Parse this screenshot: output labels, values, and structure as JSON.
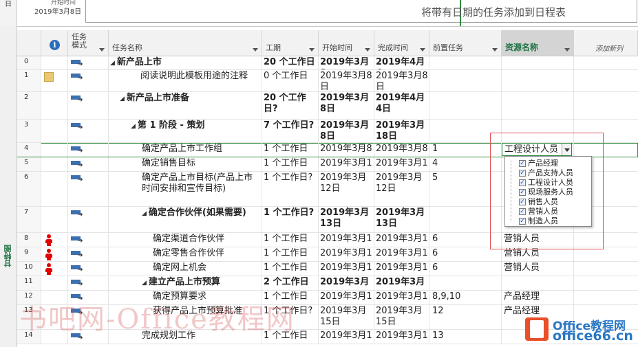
{
  "timeline": {
    "side_label": "日",
    "start_label": "开始时间",
    "start_date": "2019年3月8日",
    "hint": "将带有日期的任务添加到日程表"
  },
  "sidebar": {
    "view_label": "甘特图"
  },
  "columns": {
    "mode": "任务模式",
    "name": "任务名称",
    "duration": "工期",
    "start": "开始时间",
    "finish": "完成时间",
    "predecessors": "前置任务",
    "resource": "资源名称",
    "add": "添加新列"
  },
  "rows": [
    {
      "id": "0",
      "indicator": "",
      "name": "新产品上市",
      "summary": true,
      "duration": "20 个工作日",
      "start": "2019年3月8",
      "finish": "2019年4月4",
      "pred": "",
      "res": ""
    },
    {
      "id": "1",
      "indicator": "note",
      "name": "阅读说明此模板用途的注释",
      "summary": false,
      "duration": "0 个工作日",
      "start": "2019年3月8日",
      "finish": "2019年3月8日",
      "pred": "",
      "res": ""
    },
    {
      "id": "2",
      "indicator": "",
      "name": "新产品上市准备",
      "summary": true,
      "duration": "20 个工作日?",
      "start": "2019年3月8日",
      "finish": "2019年4月4日",
      "pred": "",
      "res": ""
    },
    {
      "id": "3",
      "indicator": "",
      "name": "第 1 阶段 - 策划",
      "summary": true,
      "duration": "7 个工作日?",
      "start": "2019年3月8日",
      "finish": "2019年3月18日",
      "pred": "",
      "res": ""
    },
    {
      "id": "4",
      "indicator": "",
      "name": "确定产品上市工作组",
      "summary": false,
      "duration": "1 个工作日",
      "start": "2019年3月8",
      "finish": "2019年3月8",
      "pred": "1",
      "res": ""
    },
    {
      "id": "5",
      "indicator": "",
      "name": "确定销售目标",
      "summary": false,
      "duration": "1 个工作日",
      "start": "2019年3月1",
      "finish": "2019年3月1",
      "pred": "4",
      "res": ""
    },
    {
      "id": "6",
      "indicator": "",
      "name": "确定产品上市目标(产品上市时间安排和宣传目标)",
      "summary": false,
      "duration": "1 个工作日?",
      "start": "2019年3月12日",
      "finish": "2019年3月12日",
      "pred": "5",
      "res": ""
    },
    {
      "id": "7",
      "indicator": "",
      "name": "确定合作伙伴(如果需要)",
      "summary": true,
      "duration": "1 个工作日?",
      "start": "2019年3月13日",
      "finish": "2019年3月13日",
      "pred": "",
      "res": ""
    },
    {
      "id": "8",
      "indicator": "person",
      "name": "确定渠道合作伙伴",
      "summary": false,
      "duration": "1 个工作日",
      "start": "2019年3月1",
      "finish": "2019年3月1",
      "pred": "6",
      "res": "营销人员"
    },
    {
      "id": "9",
      "indicator": "person",
      "name": "确定零售合作伙伴",
      "summary": false,
      "duration": "1 个工作日",
      "start": "2019年3月1",
      "finish": "2019年3月1",
      "pred": "6",
      "res": "营销人员"
    },
    {
      "id": "10",
      "indicator": "person",
      "name": "确定网上机会",
      "summary": false,
      "duration": "1 个工作日",
      "start": "2019年3月1",
      "finish": "2019年3月1",
      "pred": "6",
      "res": "营销人员"
    },
    {
      "id": "11",
      "indicator": "",
      "name": "建立产品上市预算",
      "summary": true,
      "duration": "2 个工作日",
      "start": "2019年3月",
      "finish": "2019年3月",
      "pred": "",
      "res": ""
    },
    {
      "id": "12",
      "indicator": "",
      "name": "确定预算要求",
      "summary": false,
      "duration": "1 个工作日",
      "start": "2019年3月1",
      "finish": "2019年3月1",
      "pred": "8,9,10",
      "res": "产品经理"
    },
    {
      "id": "13",
      "indicator": "",
      "name": "获得产品上市预算批准",
      "summary": false,
      "duration": "1 个工作日?",
      "start": "2019年3月15日",
      "finish": "2019年3月15日",
      "pred": "12",
      "res": "产品经理"
    },
    {
      "id": "14",
      "indicator": "",
      "name": "完成规划工作",
      "summary": false,
      "duration": "1 个工作日",
      "start": "2019年3月1",
      "finish": "2019年3月1",
      "pred": "13",
      "res": ""
    }
  ],
  "resource_editor": {
    "current_value": "工程设计人员",
    "options": [
      {
        "label": "产品经理",
        "checked": true
      },
      {
        "label": "产品支持人员",
        "checked": true
      },
      {
        "label": "工程设计人员",
        "checked": true
      },
      {
        "label": "现场服务人员",
        "checked": true
      },
      {
        "label": "销售人员",
        "checked": true
      },
      {
        "label": "营销人员",
        "checked": true
      },
      {
        "label": "制造人员",
        "checked": true
      }
    ]
  },
  "watermark": {
    "text": "书吧网-Office教程网"
  },
  "brand": {
    "line1": "Office教程网",
    "line2": "office66.cn"
  }
}
